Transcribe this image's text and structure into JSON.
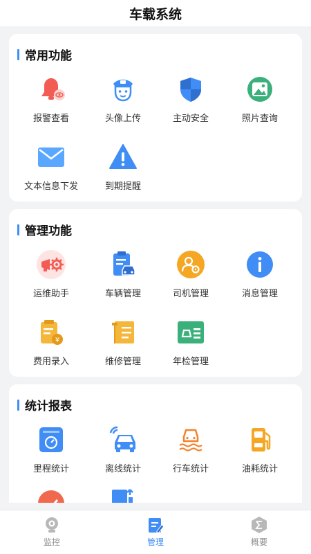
{
  "header": {
    "title": "车载系统"
  },
  "sections": [
    {
      "title": "常用功能",
      "items": [
        {
          "label": "报警查看",
          "icon": "alarm-bell-icon"
        },
        {
          "label": "头像上传",
          "icon": "police-avatar-icon"
        },
        {
          "label": "主动安全",
          "icon": "shield-icon"
        },
        {
          "label": "照片查询",
          "icon": "photo-icon"
        },
        {
          "label": "文本信息下发",
          "icon": "envelope-icon"
        },
        {
          "label": "到期提醒",
          "icon": "warning-triangle-icon"
        }
      ]
    },
    {
      "title": "管理功能",
      "items": [
        {
          "label": "运维助手",
          "icon": "maintenance-assistant-icon"
        },
        {
          "label": "车辆管理",
          "icon": "vehicle-clipboard-icon"
        },
        {
          "label": "司机管理",
          "icon": "driver-icon"
        },
        {
          "label": "消息管理",
          "icon": "info-icon"
        },
        {
          "label": "费用录入",
          "icon": "fee-document-icon"
        },
        {
          "label": "维修管理",
          "icon": "repair-wrench-icon"
        },
        {
          "label": "年检管理",
          "icon": "inspection-card-icon"
        }
      ]
    },
    {
      "title": "统计报表",
      "items": [
        {
          "label": "里程统计",
          "icon": "odometer-icon"
        },
        {
          "label": "离线统计",
          "icon": "offline-car-icon"
        },
        {
          "label": "行车统计",
          "icon": "driving-car-icon"
        },
        {
          "label": "油耗统计",
          "icon": "fuel-pump-icon"
        }
      ]
    }
  ],
  "tabs": [
    {
      "label": "监控",
      "icon": "monitor-camera-icon",
      "active": false
    },
    {
      "label": "管理",
      "icon": "manage-clipboard-icon",
      "active": true
    },
    {
      "label": "概要",
      "icon": "summary-sigma-icon",
      "active": false
    }
  ],
  "colors": {
    "accent": "#3f8df5",
    "alarm": "#f25c54",
    "orange": "#f5a623",
    "green": "#3bb07a",
    "blue": "#3f8df5"
  }
}
